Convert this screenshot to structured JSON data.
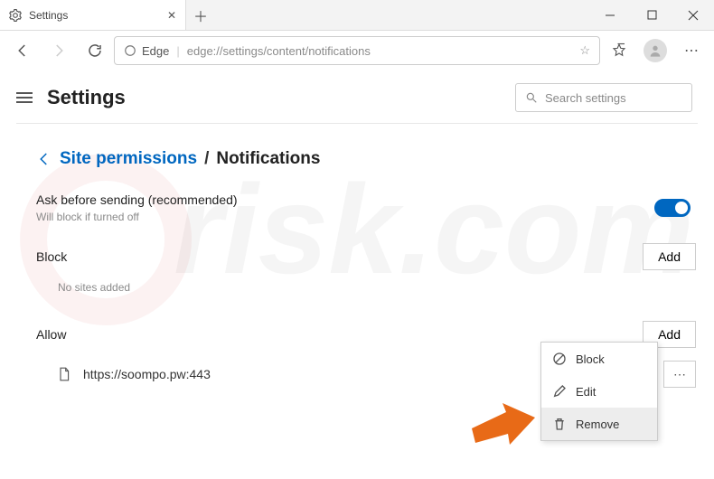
{
  "window": {
    "tab_title": "Settings",
    "browser_label": "Edge",
    "url": "edge://settings/content/notifications"
  },
  "header": {
    "page_title": "Settings",
    "search_placeholder": "Search settings"
  },
  "breadcrumb": {
    "parent": "Site permissions",
    "slash": "/",
    "current": "Notifications"
  },
  "ask": {
    "label": "Ask before sending (recommended)",
    "sub": "Will block if turned off"
  },
  "block": {
    "title": "Block",
    "add": "Add",
    "empty": "No sites added"
  },
  "allow": {
    "title": "Allow",
    "add": "Add",
    "site": "https://soompo.pw:443"
  },
  "menu": {
    "block": "Block",
    "edit": "Edit",
    "remove": "Remove"
  }
}
